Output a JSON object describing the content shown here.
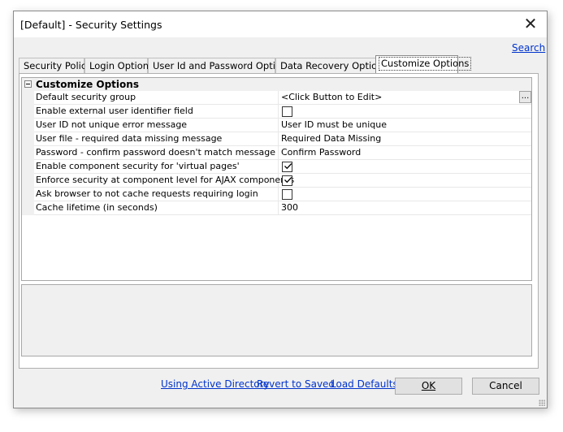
{
  "window": {
    "title": "[Default] - Security Settings",
    "close_symbol": "✕"
  },
  "search_link": "Search",
  "tabs": [
    {
      "label": "Security Policy",
      "active": false
    },
    {
      "label": "Login Options",
      "active": false
    },
    {
      "label": "User Id and Password Options",
      "active": false
    },
    {
      "label": "Data Recovery Options",
      "active": false
    },
    {
      "label": "Customize Options",
      "active": true
    }
  ],
  "grid": {
    "category": "Customize Options",
    "rows": [
      {
        "name": "Default security group",
        "type": "text",
        "value": "<Click Button to Edit>",
        "has_button": true,
        "button_label": "..."
      },
      {
        "name": "Enable external user identifier field",
        "type": "checkbox",
        "checked": false
      },
      {
        "name": "User ID not unique error message",
        "type": "text",
        "value": "User ID must be unique"
      },
      {
        "name": "User file - required data missing message",
        "type": "text",
        "value": "Required Data Missing"
      },
      {
        "name": "Password - confirm password doesn't match message",
        "type": "text",
        "value": "Confirm Password"
      },
      {
        "name": "Enable component security for 'virtual pages'",
        "type": "checkbox",
        "checked": true
      },
      {
        "name": "Enforce security at component level for AJAX components",
        "type": "checkbox",
        "checked": true
      },
      {
        "name": "Ask browser to not cache requests requiring login",
        "type": "checkbox",
        "checked": false
      },
      {
        "name": "Cache lifetime (in seconds)",
        "type": "text",
        "value": "300"
      }
    ]
  },
  "footer": {
    "links": [
      "Using Active Directory",
      "Revert to Saved",
      "Load Defaults"
    ],
    "ok_label": "OK",
    "cancel_label": "Cancel"
  },
  "icons": {
    "expander": "collapse-icon",
    "check": "checkmark-icon",
    "close": "close-icon",
    "grip": "resize-grip-icon"
  }
}
